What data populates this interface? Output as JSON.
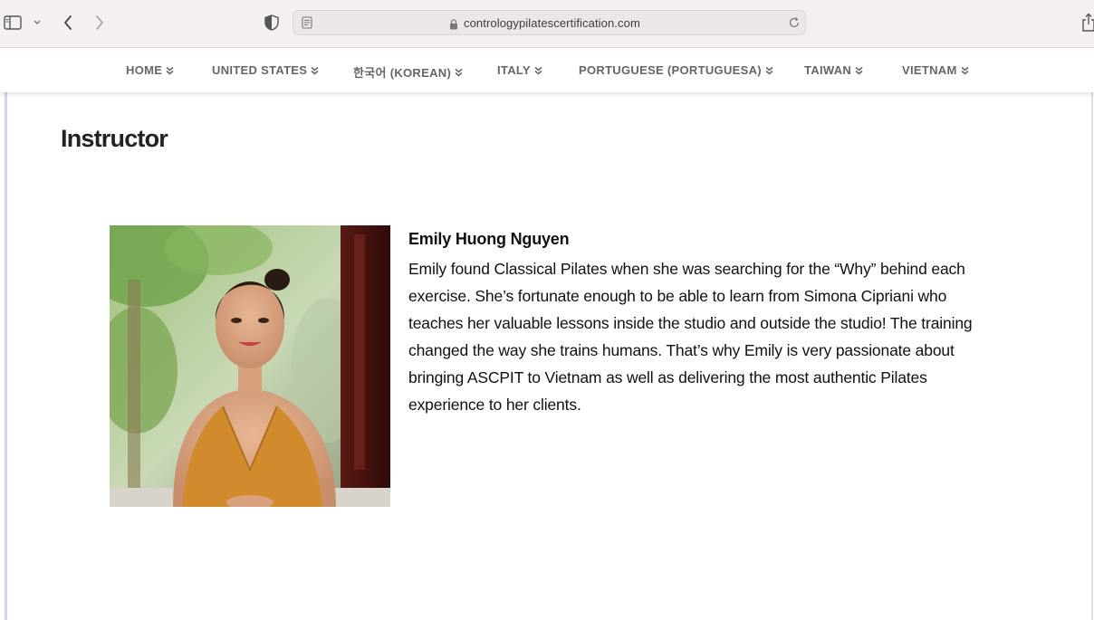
{
  "browser": {
    "url": "contrologypilatescertification.com"
  },
  "nav": {
    "items": [
      {
        "label": "HOME"
      },
      {
        "label": "UNITED STATES"
      },
      {
        "label": "한국어 (KOREAN)"
      },
      {
        "label": "ITALY"
      },
      {
        "label": "PORTUGUESE (PORTUGUESA)"
      },
      {
        "label": "TAIWAN"
      },
      {
        "label": "VIETNAM"
      }
    ]
  },
  "section": {
    "title": "Instructor"
  },
  "instructor": {
    "name": "Emily Huong Nguyen",
    "bio": "Emily found Classical Pilates when she was searching for the “Why” behind each exercise. She’s fortunate enough to be able to learn from Simona Cipriani who teaches her valuable lessons inside the studio and outside the studio! The training changed the way she trains humans. That’s why Emily is very passionate about bringing ASCPIT to Vietnam as well as delivering the most authentic Pilates experience to her clients."
  },
  "colors": {
    "nav_text": "#666666",
    "title": "#222222",
    "body_text": "#111111",
    "left_accent": "#d6d2f2"
  },
  "icons": [
    "sidebar-icon",
    "chevron-down-icon",
    "back-icon",
    "forward-icon",
    "shield-icon",
    "reader-icon",
    "lock-icon",
    "reload-icon",
    "share-icon",
    "double-chevron-down-icon"
  ]
}
